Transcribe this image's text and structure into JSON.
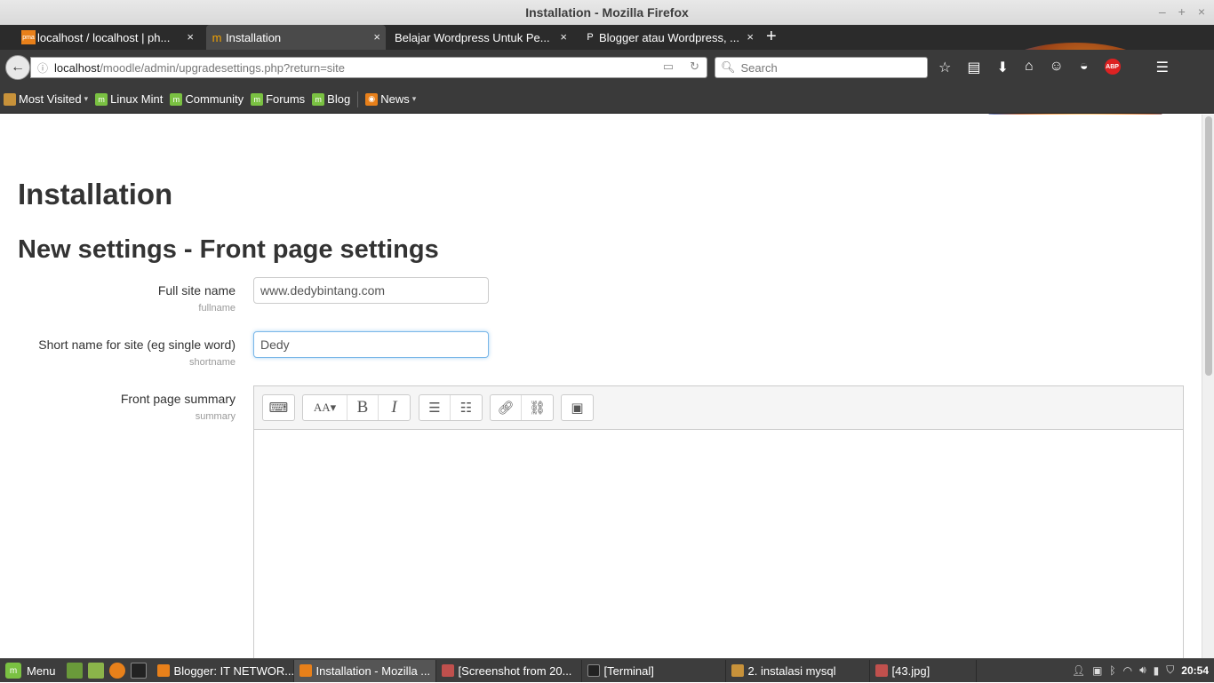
{
  "window": {
    "title": "Installation - Mozilla Firefox",
    "controls": [
      "–",
      "+",
      "×"
    ]
  },
  "tabs": [
    {
      "label": "localhost / localhost | ph...",
      "icon": "pma",
      "close": "×"
    },
    {
      "label": "Installation",
      "icon": "moodle",
      "close": "×"
    },
    {
      "label": "Belajar Wordpress Untuk Pe...",
      "icon": "",
      "close": "×"
    },
    {
      "label": "Blogger atau Wordpress, ...",
      "icon": "P",
      "close": "×"
    }
  ],
  "newtab": "+",
  "navbar": {
    "url_host": "localhost",
    "url_path": "/moodle/admin/upgradesettings.php?return=site",
    "search_placeholder": "Search",
    "abp_label": "ABP"
  },
  "bookmarks": [
    {
      "label": "Most Visited",
      "caret": "▾"
    },
    {
      "label": "Linux Mint",
      "caret": ""
    },
    {
      "label": "Community",
      "caret": ""
    },
    {
      "label": "Forums",
      "caret": ""
    },
    {
      "label": "Blog",
      "caret": ""
    },
    {
      "label": "News",
      "caret": "▾"
    }
  ],
  "page": {
    "title": "Installation",
    "subtitle": "New settings - Front page settings",
    "fields": [
      {
        "label": "Full site name",
        "key": "fullname",
        "value": "www.dedybintang.com"
      },
      {
        "label": "Short name for site (eg single word)",
        "key": "shortname",
        "value": "Dedy"
      },
      {
        "label": "Front page summary",
        "key": "summary",
        "value": ""
      }
    ]
  },
  "taskbar": {
    "menu_label": "Menu",
    "tasks": [
      {
        "label": "Blogger: IT NETWOR...",
        "color": "#e8801a"
      },
      {
        "label": "Installation - Mozilla ...",
        "color": "#e8801a"
      },
      {
        "label": "[Screenshot from 20...",
        "color": "#c0504d"
      },
      {
        "label": "[Terminal]",
        "color": "#222222"
      },
      {
        "label": "2. instalasi mysql",
        "color": "#c8923a"
      },
      {
        "label": "[43.jpg]",
        "color": "#c0504d"
      }
    ],
    "clock": "20:54"
  }
}
